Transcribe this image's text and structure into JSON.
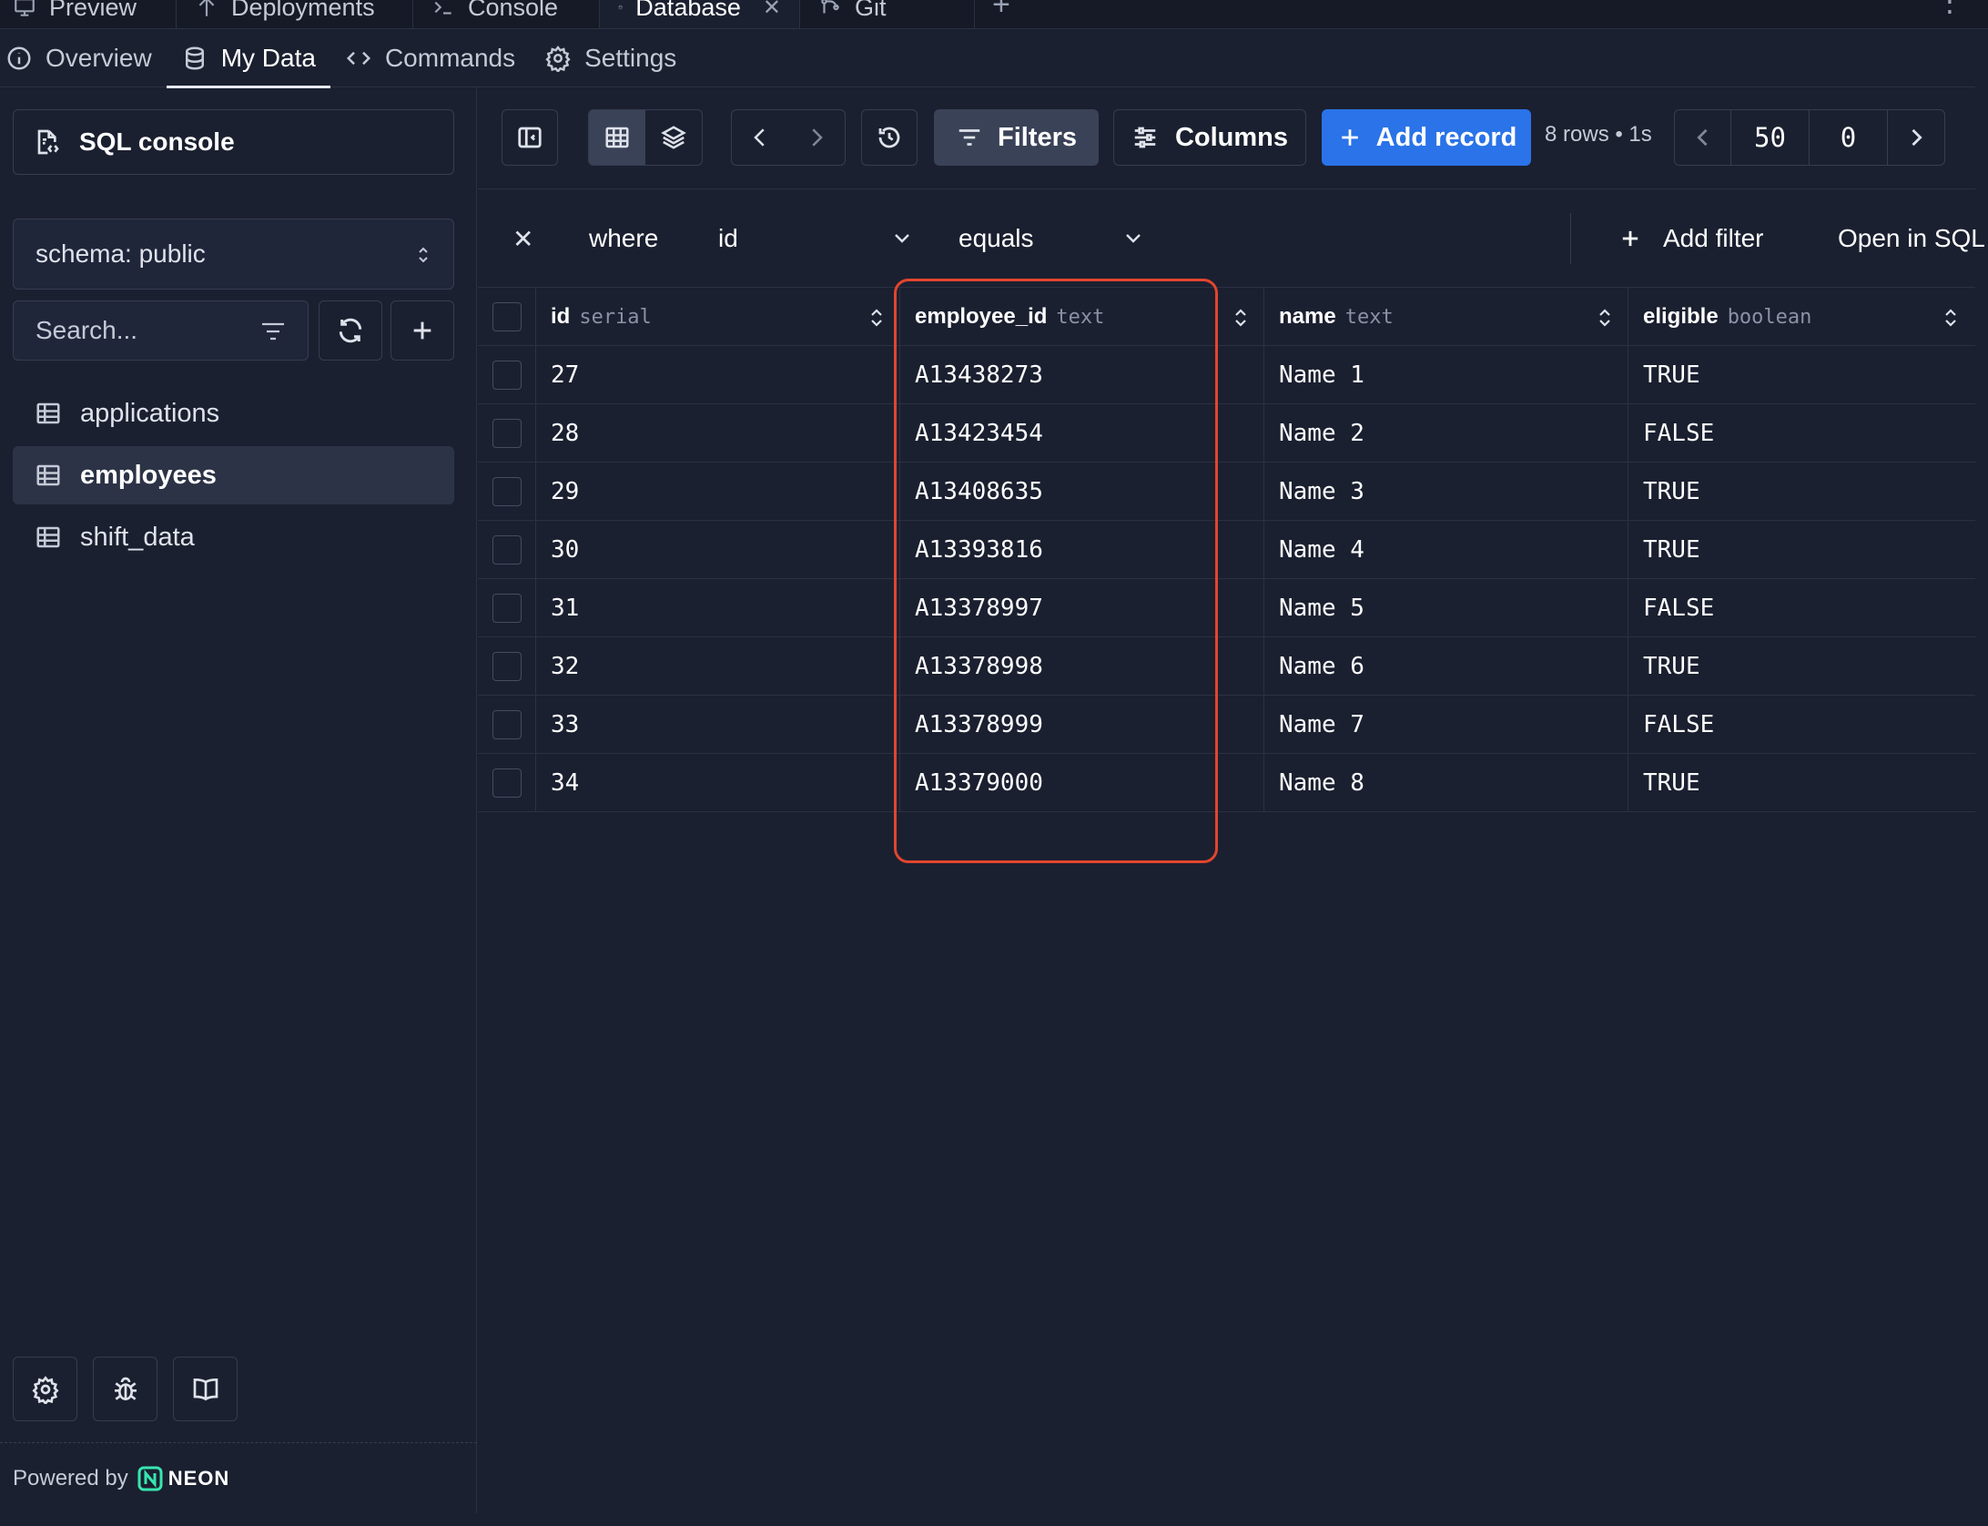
{
  "top_tabs": [
    {
      "label": "Preview",
      "icon": "monitor-icon"
    },
    {
      "label": "Deployments",
      "icon": "deploy-icon"
    },
    {
      "label": "Console",
      "icon": "terminal-icon"
    },
    {
      "label": "Database",
      "icon": "database-icon",
      "active": true
    },
    {
      "label": "Git",
      "icon": "git-icon"
    }
  ],
  "subnav": [
    {
      "label": "Overview",
      "icon": "info-icon"
    },
    {
      "label": "My Data",
      "icon": "database-icon",
      "active": true
    },
    {
      "label": "Commands",
      "icon": "code-icon"
    },
    {
      "label": "Settings",
      "icon": "gear-icon"
    }
  ],
  "sidebar": {
    "sql_console_label": "SQL console",
    "schema_label": "schema: public",
    "search_placeholder": "Search...",
    "tables": [
      {
        "name": "applications"
      },
      {
        "name": "employees",
        "active": true
      },
      {
        "name": "shift_data"
      }
    ],
    "powered_by": "Powered by",
    "brand": "NEON"
  },
  "toolbar": {
    "filters_label": "Filters",
    "columns_label": "Columns",
    "add_record_label": "Add record",
    "row_info": "8 rows • 1s",
    "page_size": "50",
    "offset": "0"
  },
  "filter": {
    "where_label": "where",
    "field": "id",
    "operator": "equals",
    "add_filter_label": "Add filter",
    "open_sql_label": "Open in SQL"
  },
  "columns": [
    {
      "name": "id",
      "type": "serial"
    },
    {
      "name": "employee_id",
      "type": "text"
    },
    {
      "name": "name",
      "type": "text"
    },
    {
      "name": "eligible",
      "type": "boolean"
    }
  ],
  "rows": [
    {
      "id": "27",
      "employee_id": "A13438273",
      "name": "Name 1",
      "eligible": "TRUE"
    },
    {
      "id": "28",
      "employee_id": "A13423454",
      "name": "Name 2",
      "eligible": "FALSE"
    },
    {
      "id": "29",
      "employee_id": "A13408635",
      "name": "Name 3",
      "eligible": "TRUE"
    },
    {
      "id": "30",
      "employee_id": "A13393816",
      "name": "Name 4",
      "eligible": "TRUE"
    },
    {
      "id": "31",
      "employee_id": "A13378997",
      "name": "Name 5",
      "eligible": "FALSE"
    },
    {
      "id": "32",
      "employee_id": "A13378998",
      "name": "Name 6",
      "eligible": "TRUE"
    },
    {
      "id": "33",
      "employee_id": "A13378999",
      "name": "Name 7",
      "eligible": "FALSE"
    },
    {
      "id": "34",
      "employee_id": "A13379000",
      "name": "Name 8",
      "eligible": "TRUE"
    }
  ],
  "colors": {
    "background": "#1b2030",
    "accent": "#2a73e8",
    "highlight": "#e2452e"
  }
}
